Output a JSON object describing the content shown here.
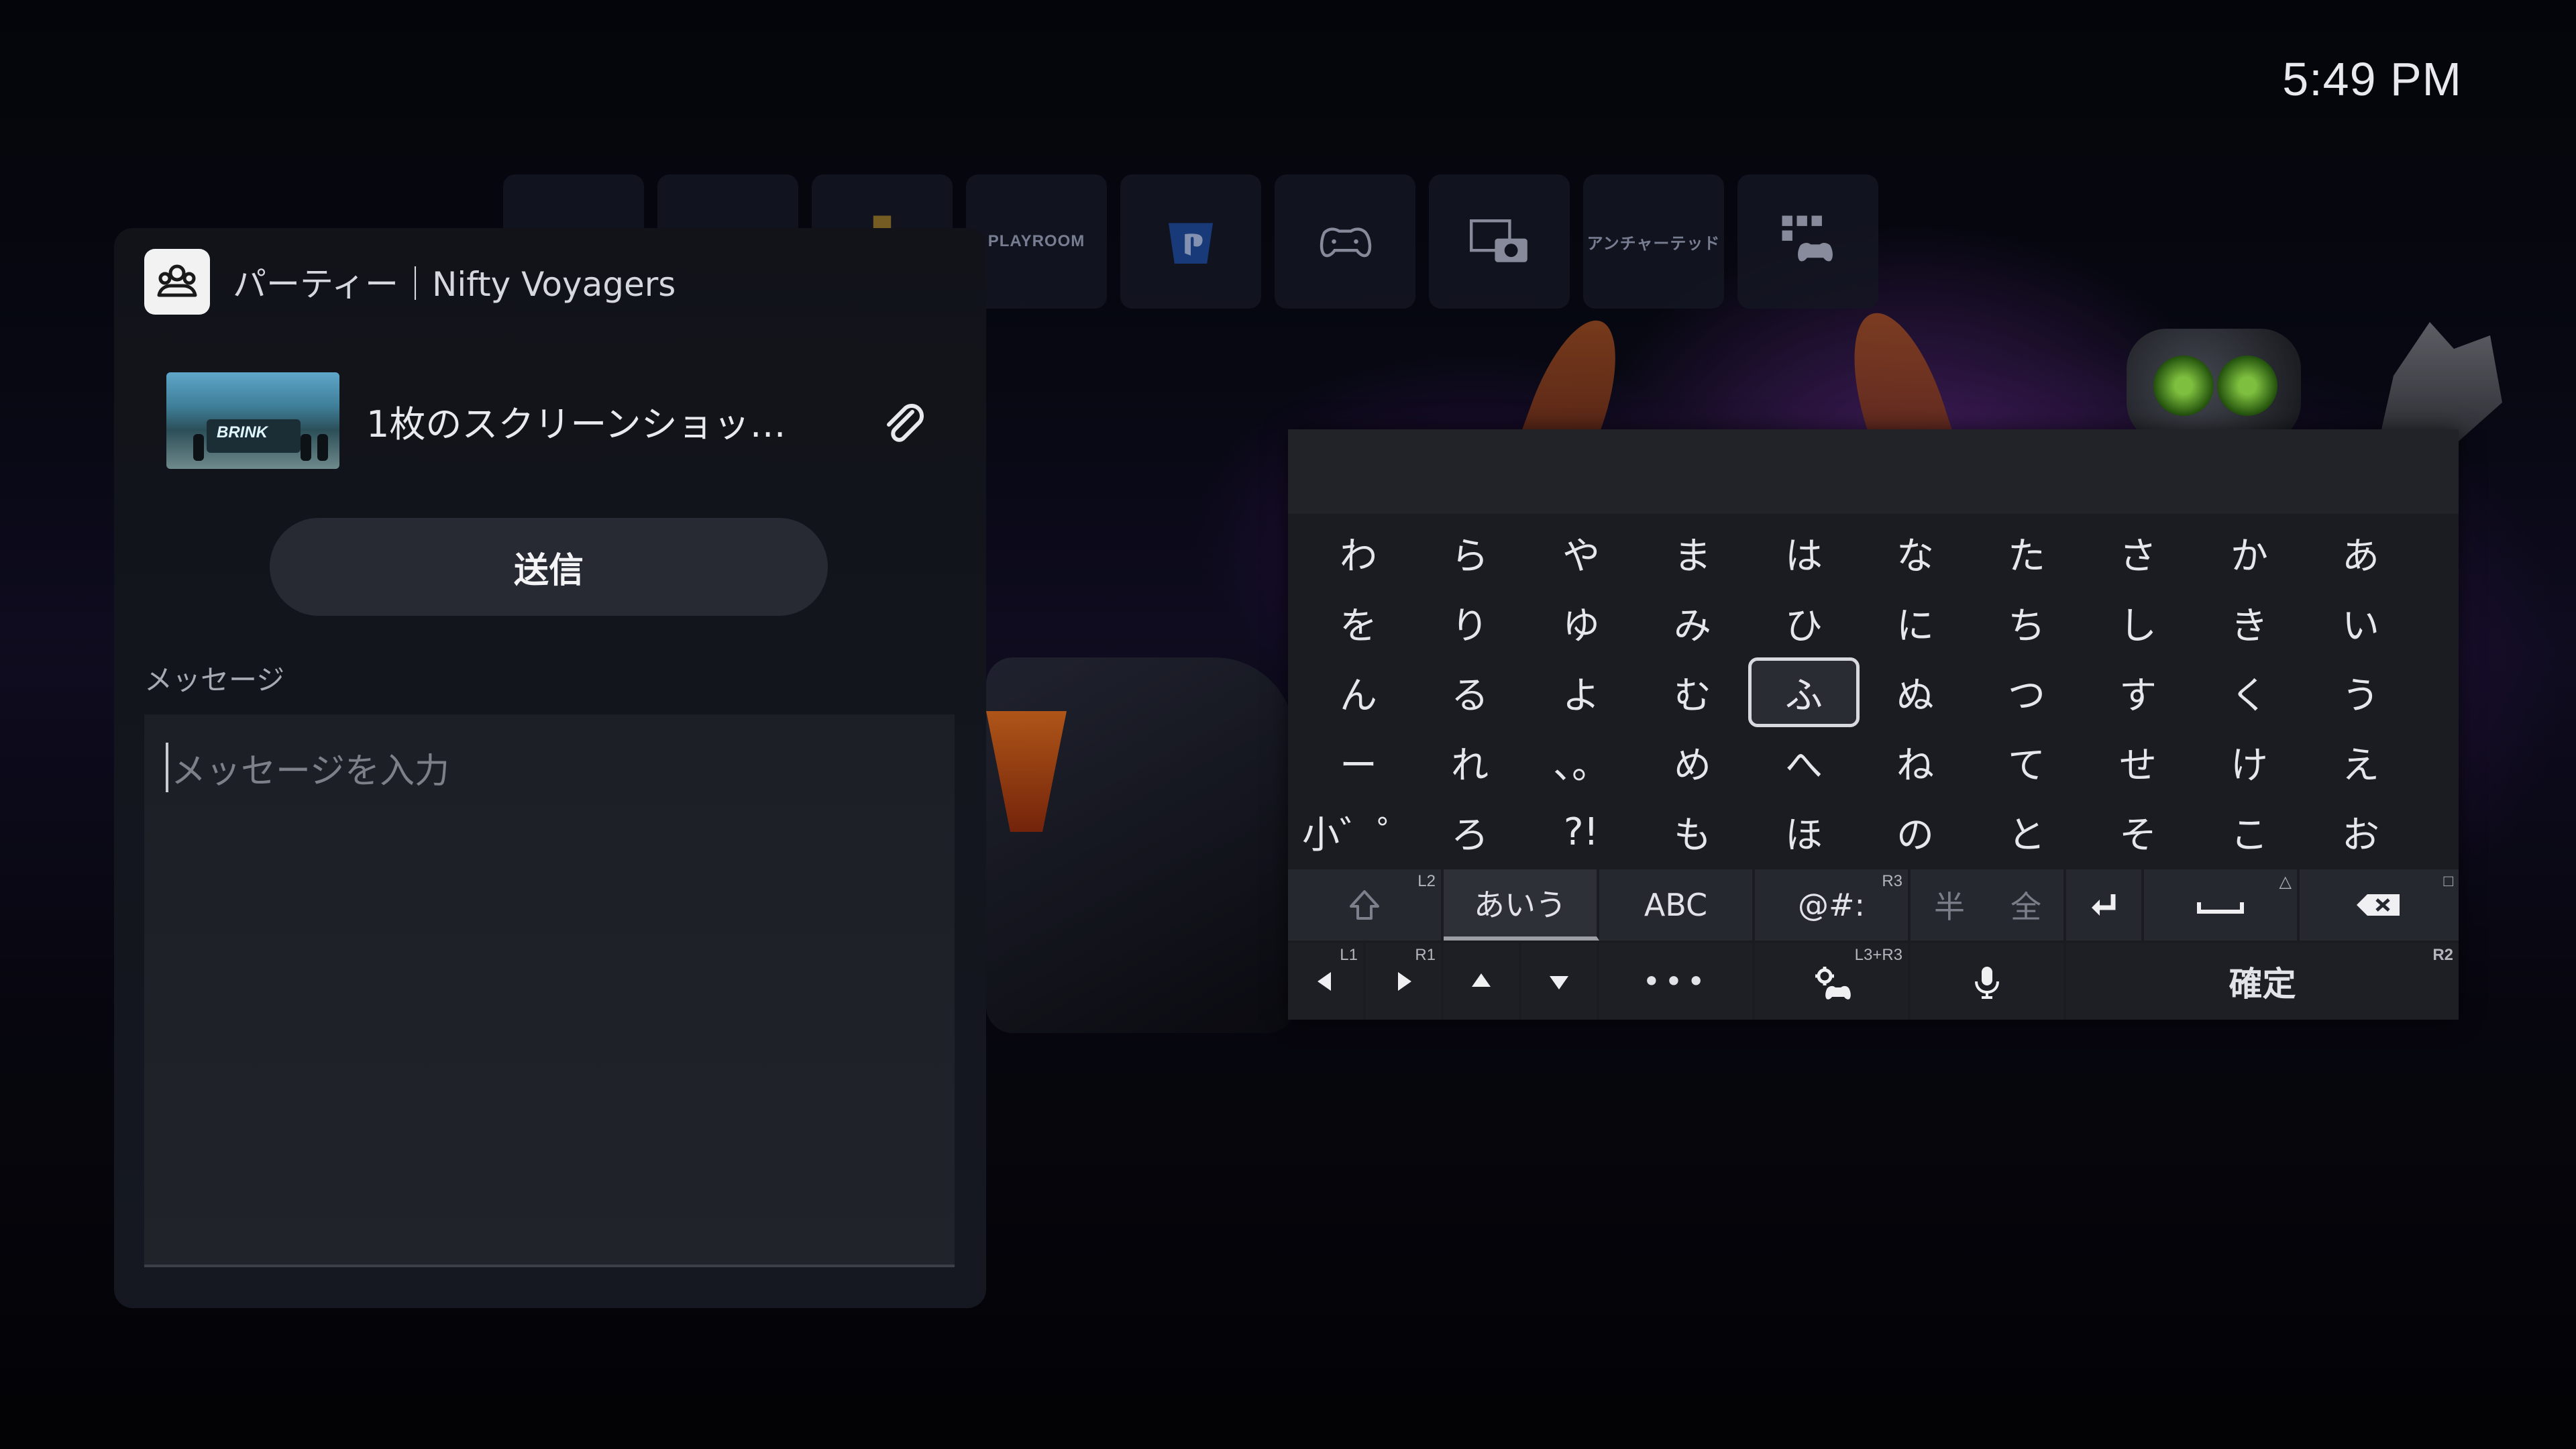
{
  "clock": "5:49 PM",
  "tiles": [
    {
      "name": "game-tile-1",
      "label": ""
    },
    {
      "name": "game-tile-2",
      "label": ""
    },
    {
      "name": "ps-plus-tile",
      "label": ""
    },
    {
      "name": "astros-playroom-tile",
      "label": "PLAYROOM"
    },
    {
      "name": "playstation-store-tile",
      "label": ""
    },
    {
      "name": "game-controller-tile",
      "label": ""
    },
    {
      "name": "media-gallery-tile",
      "label": ""
    },
    {
      "name": "game-tile-japanese",
      "label": "アンチャーテッド"
    },
    {
      "name": "game-library-tile",
      "label": ""
    }
  ],
  "party": {
    "title": "パーティー｜Nifty Voyagers",
    "attachment_label": "1枚のスクリーンショッ…",
    "thumbnail_text": "BRINK",
    "send_label": "送信",
    "message_label": "メッセージ",
    "message_placeholder": "メッセージを入力"
  },
  "keyboard": {
    "rows": [
      [
        "わ",
        "ら",
        "や",
        "ま",
        "は",
        "な",
        "た",
        "さ",
        "か",
        "あ"
      ],
      [
        "を",
        "り",
        "ゆ",
        "み",
        "ひ",
        "に",
        "ち",
        "し",
        "き",
        "い"
      ],
      [
        "ん",
        "る",
        "よ",
        "む",
        "ふ",
        "ぬ",
        "つ",
        "す",
        "く",
        "う"
      ],
      [
        "ー",
        "れ",
        "、。",
        "め",
        "へ",
        "ね",
        "て",
        "せ",
        "け",
        "え"
      ],
      [
        "小゛゜",
        "ろ",
        "?!",
        "も",
        "ほ",
        "の",
        "と",
        "そ",
        "こ",
        "お"
      ]
    ],
    "selected_key": "ふ",
    "row1": {
      "shift_tag": "L2",
      "hiragana_label": "あいう",
      "alpha_label": "ABC",
      "symbol_label": "@#:",
      "symbol_tag": "R3",
      "half_label": "半",
      "full_label": "全",
      "space_tag": "△",
      "backspace_tag": "□"
    },
    "row2": {
      "left_tag": "L1",
      "right_tag": "R1",
      "more_label": "•••",
      "settings_tag": "L3+R3",
      "confirm_label": "確定",
      "confirm_tag": "R2"
    }
  }
}
